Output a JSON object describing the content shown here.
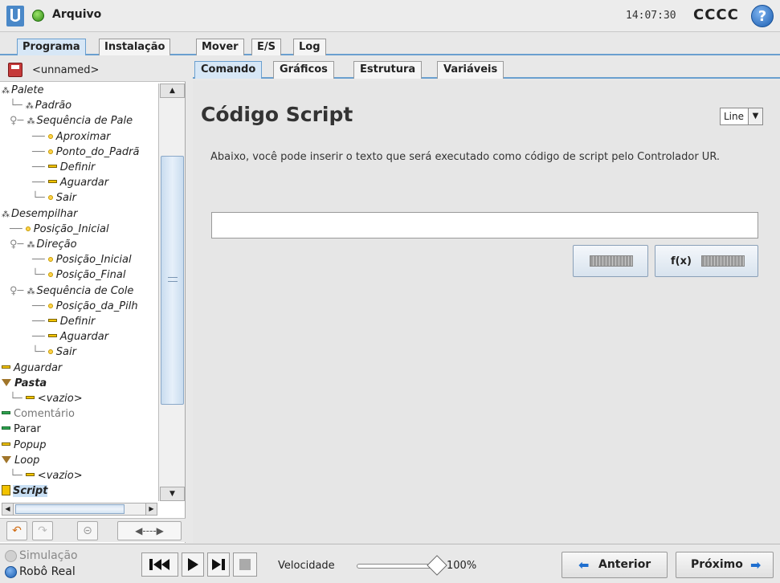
{
  "header": {
    "app_title": "Arquivo",
    "clock": "14:07:30",
    "robot_name": "CCCC",
    "help_symbol": "?"
  },
  "main_tabs": [
    "Programa",
    "Instalação",
    "Mover",
    "E/S",
    "Log"
  ],
  "left": {
    "filename": "<unnamed>",
    "tree": [
      {
        "label": "Palete",
        "icon": "pallet-icon",
        "indent": 0,
        "style": "italic",
        "prefix": ""
      },
      {
        "label": "Padrão",
        "icon": "pallet-icon",
        "indent": 1,
        "style": "italic",
        "prefix": "└"
      },
      {
        "label": "Sequência de Pale",
        "icon": "pallet-icon",
        "indent": 1,
        "style": "italic",
        "prefix": "♀"
      },
      {
        "label": "Aproximar",
        "icon": "waypoint-icon",
        "indent": 2,
        "style": "italic",
        "prefix": "─"
      },
      {
        "label": "Ponto_do_Padrã",
        "icon": "waypoint-icon",
        "indent": 2,
        "style": "italic",
        "prefix": "─"
      },
      {
        "label": "Definir",
        "icon": "set-icon",
        "indent": 2,
        "style": "italic",
        "prefix": "─"
      },
      {
        "label": "Aguardar",
        "icon": "wait-icon",
        "indent": 2,
        "style": "italic",
        "prefix": "─"
      },
      {
        "label": "Sair",
        "icon": "waypoint-icon",
        "indent": 2,
        "style": "italic",
        "prefix": "└"
      },
      {
        "label": "Desempilhar",
        "icon": "pallet-icon",
        "indent": 0,
        "style": "italic",
        "prefix": ""
      },
      {
        "label": "Posição_Inicial",
        "icon": "waypoint-icon",
        "indent": 1,
        "style": "italic",
        "prefix": "─"
      },
      {
        "label": "Direção",
        "icon": "pallet-icon",
        "indent": 1,
        "style": "italic",
        "prefix": "♀"
      },
      {
        "label": "Posição_Inicial",
        "icon": "waypoint-icon",
        "indent": 2,
        "style": "italic",
        "prefix": "─"
      },
      {
        "label": "Posição_Final",
        "icon": "waypoint-icon",
        "indent": 2,
        "style": "italic",
        "prefix": "└"
      },
      {
        "label": "Sequência de Cole",
        "icon": "pallet-icon",
        "indent": 1,
        "style": "italic",
        "prefix": "♀"
      },
      {
        "label": "Posição_da_Pilh",
        "icon": "waypoint-icon",
        "indent": 2,
        "style": "italic",
        "prefix": "─"
      },
      {
        "label": "Definir",
        "icon": "set-icon",
        "indent": 2,
        "style": "italic",
        "prefix": "─"
      },
      {
        "label": "Aguardar",
        "icon": "wait-icon",
        "indent": 2,
        "style": "italic",
        "prefix": "─"
      },
      {
        "label": "Sair",
        "icon": "waypoint-icon",
        "indent": 2,
        "style": "italic",
        "prefix": "└"
      },
      {
        "label": "Aguardar",
        "icon": "wait-yellow-icon",
        "indent": 0,
        "style": "italic",
        "prefix": ""
      },
      {
        "label": "Pasta",
        "icon": "folder-icon",
        "indent": 0,
        "style": "bolditalic",
        "prefix": ""
      },
      {
        "label": "<vazio>",
        "icon": "empty-icon",
        "indent": 1,
        "style": "italic",
        "prefix": "└"
      },
      {
        "label": "Comentário",
        "icon": "comment-icon",
        "indent": 0,
        "style": "gray",
        "prefix": ""
      },
      {
        "label": "Parar",
        "icon": "stop-icon",
        "indent": 0,
        "style": "plain",
        "prefix": ""
      },
      {
        "label": "Popup",
        "icon": "popup-icon",
        "indent": 0,
        "style": "italic",
        "prefix": ""
      },
      {
        "label": "Loop",
        "icon": "loop-icon",
        "indent": 0,
        "style": "italic",
        "prefix": ""
      },
      {
        "label": "<vazio>",
        "icon": "empty-icon",
        "indent": 1,
        "style": "italic",
        "prefix": "└"
      },
      {
        "label": "Script",
        "icon": "script-icon",
        "indent": 0,
        "style": "bolditalic-selected",
        "prefix": ""
      }
    ]
  },
  "sub_tabs": [
    "Comando",
    "Gráficos",
    "Estrutura",
    "Variáveis"
  ],
  "main": {
    "title": "Código Script",
    "mode_value": "Line",
    "description": "Abaixo, você pode inserir o texto que será executado como código de script pelo Controlador UR.",
    "script_value": "",
    "fx_label": "f(x)"
  },
  "footer": {
    "simulation_label": "Simulação",
    "real_robot_label": "Robô Real",
    "speed_label": "Velocidade",
    "speed_percent": "100%",
    "speed_fraction": 1.0,
    "prev_label": "Anterior",
    "next_label": "Próximo"
  },
  "colors": {
    "accent": "#6a9fcf",
    "status_green": "#2f8a14",
    "help_blue": "#1a5db0"
  }
}
